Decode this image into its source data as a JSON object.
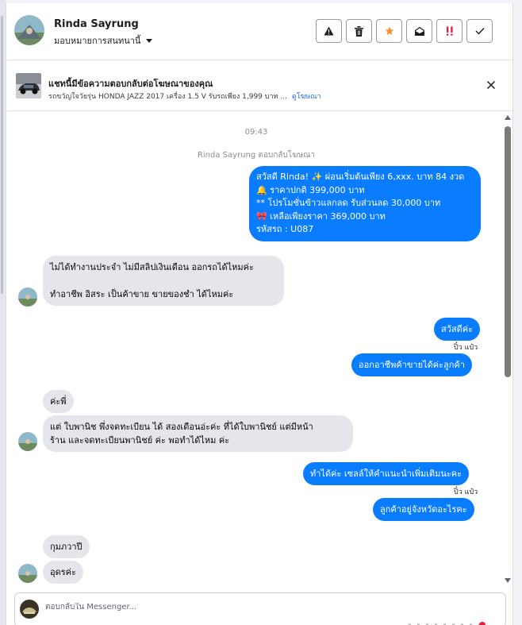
{
  "header": {
    "contact_name": "Rinda Sayrung",
    "assign_label": "มอบหมายการสนทนานี้",
    "actions": [
      "spam-icon",
      "trash-icon",
      "star-icon",
      "mark-unread-icon",
      "follow-up-icon",
      "done-icon"
    ]
  },
  "ad": {
    "title": "แชทนี้มีข้อความตอบกลับต่อโฆษณาของคุณ",
    "subtitle": "รถขวัญใจวัยรุ่น HONDA JAZZ 2017 เครื่อง 1.5 V รับรถเพียง 1,999 บาท ...",
    "link": "ดูโฆษณา"
  },
  "conversation": {
    "time": "09:43",
    "system_note": "Rinda Sayrung ตอบกลับโฆษณา",
    "promo_lines": [
      "สวัสดี Rinda! ✨ ผ่อนเริ่มต้นเพียง 6,xxx. บาท 84 งวด",
      "🔔 ราคาปกติ 399,000 บาท",
      "** โปรโมชั่นข้าวแลกลด รับส่วนลด 30,000 บาท",
      "🎀 เหลือเพียงราคา 369,000 บาท",
      "รหัสรถ : U087"
    ],
    "in_1_line1": "ไม่ได้ทำงานประจำ ไม่มีสลิปเงินเดือน ออกรถได้ไหมค่ะ",
    "in_1_line2": "ทำอาชีพ อิสระ เป็นค้าขาย ขายของชำ ได้ไหมค่ะ",
    "out_2": "สวัสดีค่ะ",
    "seen_1": "ปิ๋ว แป๋ว",
    "out_3": "ออกอาชีพค้าขายได้ค่ะลูกค้า",
    "in_2": "ค่ะพี่",
    "in_3_line1": "แต่ ใบพานิช พึ่งจดทะเบียน ได้ สองเดือนอ่ะค่ะ ที่ได้ใบพานิชย์ แต่มีหน้า",
    "in_3_line2": "ร้าน และจดทะเบียนพานิชย์ ค่ะ พอทำได้ไหม ค่ะ",
    "out_4": "ทำได้ค่ะ เซลล์ให้คำแนะนำเพิ่มเติมนะคะ",
    "seen_2": "ปิ๋ว แป๋ว",
    "out_5": "ลูกค้าอยู่จังหวัดอะไรคะ",
    "in_4": "กุมภวาปี",
    "in_5": "อุดรค่ะ"
  },
  "composer": {
    "placeholder": "ตอบกลับใน Messenger..."
  },
  "colors": {
    "outgoing": "#0a7cff",
    "incoming": "#e4e6eb",
    "star": "#f0932b",
    "follow_up": "#e41e3f",
    "link": "#216fdb"
  }
}
